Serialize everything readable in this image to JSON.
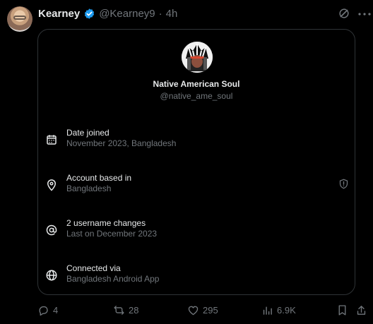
{
  "post": {
    "author_name": "Kearney",
    "handle": "@Kearney9",
    "separator": "·",
    "time": "4h"
  },
  "card": {
    "name": "Native American Soul",
    "handle": "@native_ame_soul",
    "rows": [
      {
        "icon": "calendar-icon",
        "title": "Date joined",
        "subtitle": "November 2023, Bangladesh"
      },
      {
        "icon": "location-pin-icon",
        "title": "Account based in",
        "subtitle": "Bangladesh"
      },
      {
        "icon": "at-sign-icon",
        "title": "2 username changes",
        "subtitle": "Last on December 2023"
      },
      {
        "icon": "globe-icon",
        "title": "Connected via",
        "subtitle": "Bangladesh Android App"
      }
    ]
  },
  "actions": {
    "replies": "4",
    "reposts": "28",
    "likes": "295",
    "views": "6.9K"
  },
  "colors": {
    "background": "#000000",
    "primary_text": "#e7e9ea",
    "secondary_text": "#71767b",
    "border": "#2f3336",
    "verified": "#1d9bf0"
  }
}
